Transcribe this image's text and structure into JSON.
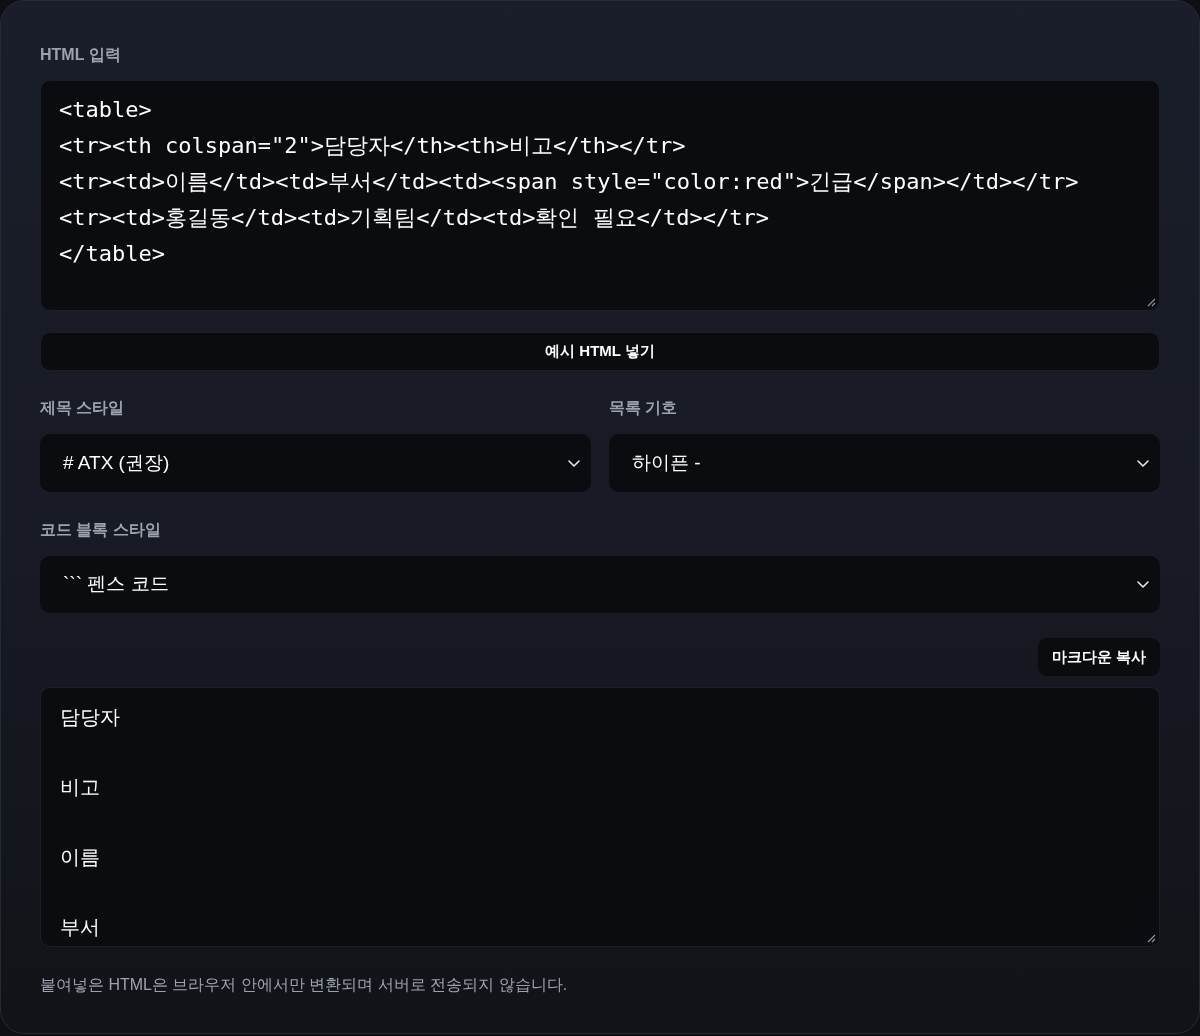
{
  "html_input": {
    "label": "HTML 입력",
    "value": "<table>\n<tr><th colspan=\"2\">담당자</th><th>비고</th></tr>\n<tr><td>이름</td><td>부서</td><td><span style=\"color:red\">긴급</span></td></tr>\n<tr><td>홍길동</td><td>기획팀</td><td>확인 필요</td></tr>\n</table>"
  },
  "sample_button": {
    "label": "예시 HTML 넣기"
  },
  "selects": [
    {
      "label": "제목 스타일",
      "value": "# ATX (권장)"
    },
    {
      "label": "목록 기호",
      "value": "하이픈 -"
    },
    {
      "label": "코드 블록 스타일",
      "value": "``` 펜스 코드"
    }
  ],
  "copy_button": {
    "label": "마크다운 복사"
  },
  "output": {
    "value": "담당자\n\n비고\n\n이름\n\n부서"
  },
  "note": "붙여넣은 HTML은 브라우저 안에서만 변환되며 서버로 전송되지 않습니다."
}
